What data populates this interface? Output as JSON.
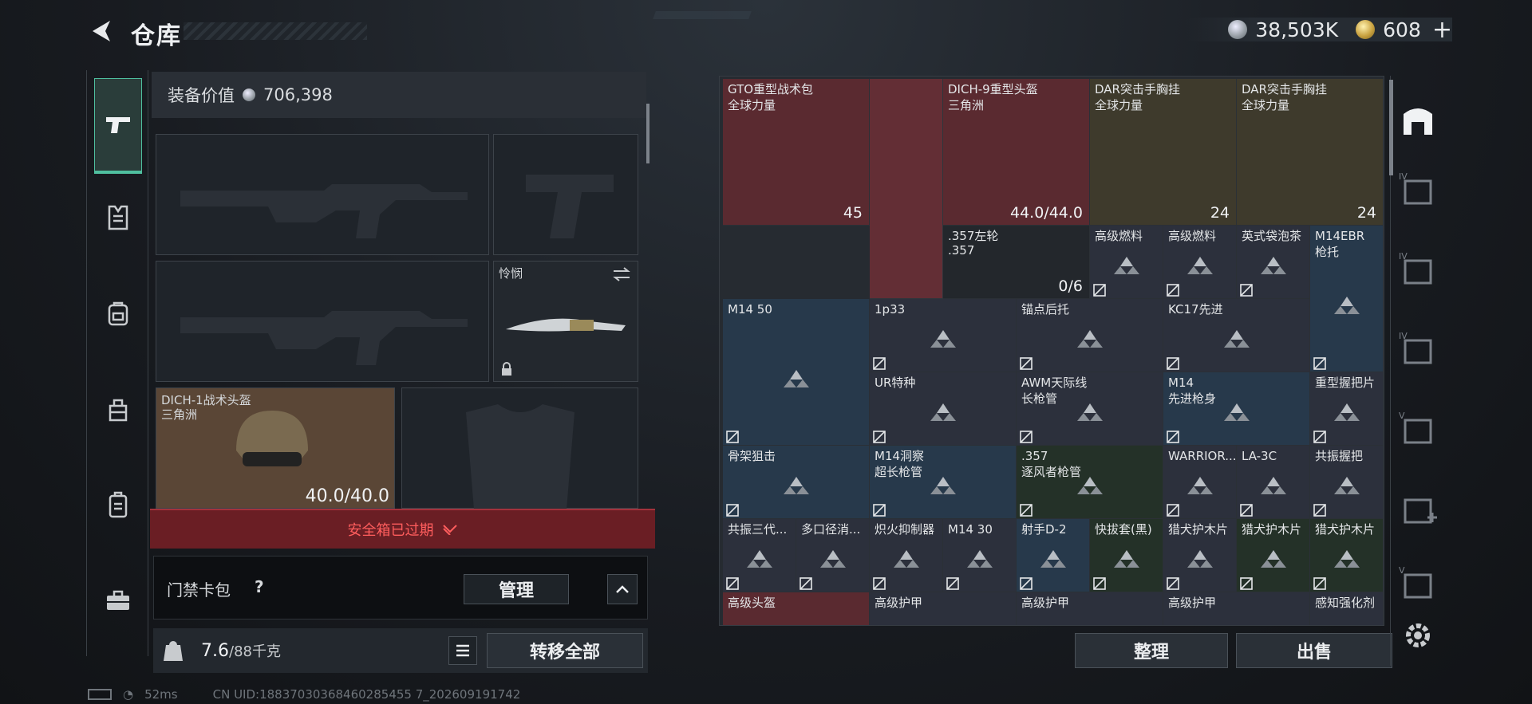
{
  "header": {
    "title": "仓库",
    "silver_amount": "38,503K",
    "gold_amount": "608",
    "plus_label": "+"
  },
  "equipment": {
    "value_label": "装备价值",
    "value": "706,398",
    "melee": {
      "name": "怜悯"
    },
    "helmet": {
      "name": "DICH-1战术头盔",
      "faction": "三角洲",
      "durability": "40.0/40.0"
    },
    "safebox_label": "安全箱已过期",
    "keycard_label": "门禁卡包",
    "keycard_help": "?",
    "manage_label": "管理",
    "weight_value": "7.6",
    "weight_max": "/88千克",
    "transfer_label": "转移全部"
  },
  "inventory": {
    "items": [
      {
        "name": "GTO重型战术包",
        "sub": "全球力量",
        "qty": "45"
      },
      {
        "name": "DICH-9重型头盔",
        "sub": "三角洲",
        "qty": "44.0/44.0"
      },
      {
        "name": "DAR突击手胸挂",
        "sub": "全球力量",
        "qty": "24"
      },
      {
        "name": "DAR突击手胸挂",
        "sub": "全球力量",
        "qty": "24"
      },
      {
        "name": ".357左轮",
        "sub": ".357",
        "qty": "0/6"
      },
      {
        "name": "高级燃料"
      },
      {
        "name": "高级燃料"
      },
      {
        "name": "英式袋泡茶"
      },
      {
        "name": "M14EBR",
        "sub": "枪托"
      },
      {
        "name": "M14 50"
      },
      {
        "name": "1p33"
      },
      {
        "name": "锚点后托"
      },
      {
        "name": "KC17先进"
      },
      {
        "name": "UR特种"
      },
      {
        "name": "AWM天际线",
        "sub": "长枪管"
      },
      {
        "name": "M14",
        "sub": "先进枪身"
      },
      {
        "name": "重型握把片"
      },
      {
        "name": "骨架狙击"
      },
      {
        "name": "M14洞察",
        "sub": "超长枪管"
      },
      {
        "name": ".357",
        "sub": "逐风者枪管"
      },
      {
        "name": "WARRIOR..."
      },
      {
        "name": "LA-3C"
      },
      {
        "name": "共振握把"
      },
      {
        "name": "共振三代..."
      },
      {
        "name": "多口径消..."
      },
      {
        "name": "炽火抑制器"
      },
      {
        "name": "M14 30"
      },
      {
        "name": "射手D-2"
      },
      {
        "name": "快拔套(黑)"
      },
      {
        "name": "猎犬护木片"
      },
      {
        "name": "猎犬护木片"
      },
      {
        "name": "猎犬护木片"
      },
      {
        "name": "高级头盔"
      },
      {
        "name": "高级护甲"
      },
      {
        "name": "高级护甲"
      },
      {
        "name": "高级护甲"
      },
      {
        "name": "感知强化剂"
      }
    ],
    "sort_label": "整理",
    "sell_label": "出售"
  },
  "status": {
    "ping": "52ms",
    "uid": "CN UID:18837030368460285455 7_202609191742"
  },
  "colors": {
    "accent": "#4fbf9f",
    "warning": "#ff5d5d"
  }
}
